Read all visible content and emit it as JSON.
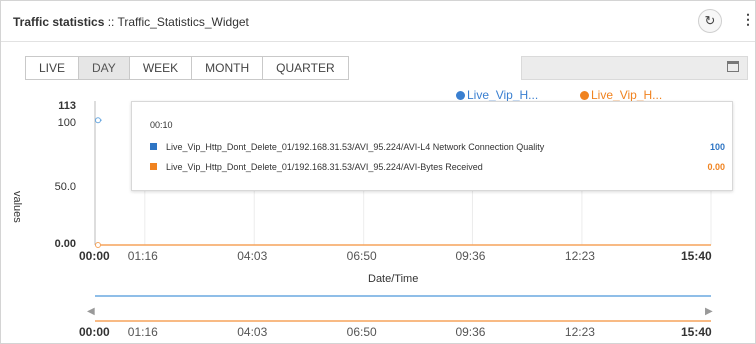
{
  "widget": {
    "title_bold": "Traffic statistics",
    "title_rest": " :: Traffic_Statistics_Widget",
    "refresh_icon": "refresh-icon",
    "menu_icon": "vertical-dots-icon"
  },
  "tabs": [
    {
      "label": "LIVE",
      "active": false
    },
    {
      "label": "DAY",
      "active": true
    },
    {
      "label": "WEEK",
      "active": false
    },
    {
      "label": "MONTH",
      "active": false
    },
    {
      "label": "QUARTER",
      "active": false
    }
  ],
  "legend": [
    {
      "label": "Live_Vip_H...",
      "color": "#3a7fd0"
    },
    {
      "label": "Live_Vip_H...",
      "color": "#f08320"
    }
  ],
  "tooltip": {
    "time": "00:10",
    "rows": [
      {
        "label": "Live_Vip_Http_Dont_Delete_01/192.168.31.53/AVI_95.224/AVI-L4 Network Connection Quality",
        "value": "100",
        "color": "#2e75c4",
        "value_color": "#2e75c4"
      },
      {
        "label": "Live_Vip_Http_Dont_Delete_01/192.168.31.53/AVI_95.224/AVI-Bytes Received",
        "value": "0.00",
        "color": "#f08320",
        "value_color": "#f08320"
      }
    ]
  },
  "chart_data": {
    "type": "line",
    "ylabel": "values",
    "xlabel": "Date/Time",
    "y_ticks": [
      "113",
      "100",
      "50.0",
      "0.00"
    ],
    "ylim": [
      0,
      113
    ],
    "x_ticks": [
      "00:00",
      "01:16",
      "04:03",
      "06:50",
      "09:36",
      "12:23",
      "15:40"
    ],
    "x_ticks_bold": [
      true,
      false,
      false,
      false,
      false,
      false,
      true
    ],
    "xlim": [
      "00:00",
      "15:40"
    ],
    "series": [
      {
        "color": "#6aa8e0",
        "x": [
          "00:00",
          "00:10"
        ],
        "values": [
          100,
          100
        ]
      },
      {
        "color": "#f5a45c",
        "x": [
          "00:00",
          "15:40"
        ],
        "values": [
          0,
          0
        ]
      }
    ],
    "navigator": {
      "x_ticks": [
        "00:00",
        "01:16",
        "04:03",
        "06:50",
        "09:36",
        "12:23",
        "15:40"
      ]
    }
  }
}
